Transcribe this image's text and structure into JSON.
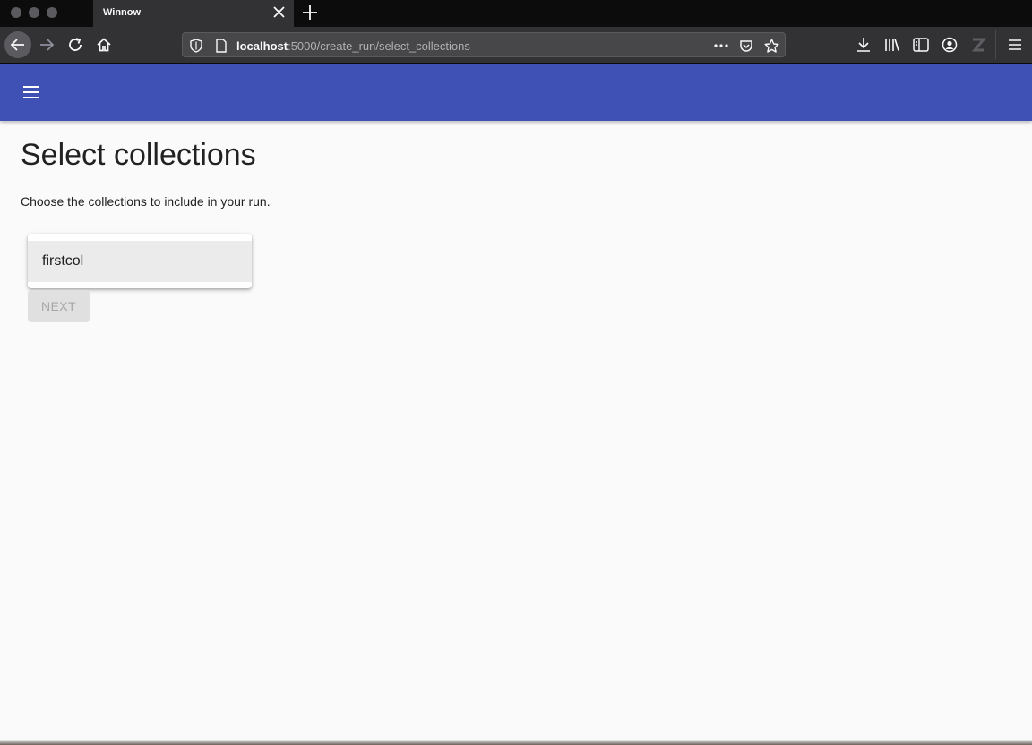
{
  "browser": {
    "tab_title": "Winnow",
    "url_host": "localhost",
    "url_rest": ":5000/create_run/select_collections",
    "colors": {
      "tabbar": "#0c0c0d",
      "toolbar": "#323234",
      "urlbar": "#474749"
    }
  },
  "appbar": {
    "color": "#3f51b5",
    "menu_icon": "hamburger-menu-icon"
  },
  "page": {
    "title": "Select collections",
    "instructions": "Choose the collections to include in your run.",
    "collections": [
      {
        "label": "firstcol"
      }
    ],
    "next_label": "NEXT",
    "next_disabled": true
  },
  "icons": {
    "back": "back-arrow-icon",
    "forward": "forward-arrow-icon",
    "reload": "reload-icon",
    "home": "home-icon",
    "shield": "shield-icon",
    "page": "page-icon",
    "more": "more-dots-icon",
    "pocket": "pocket-icon",
    "bookmark": "star-icon",
    "download": "download-icon",
    "library": "library-icon",
    "sidebar": "sidebar-icon",
    "account": "account-icon",
    "extension": "extension-icon",
    "menu": "hamburger-menu-icon"
  }
}
